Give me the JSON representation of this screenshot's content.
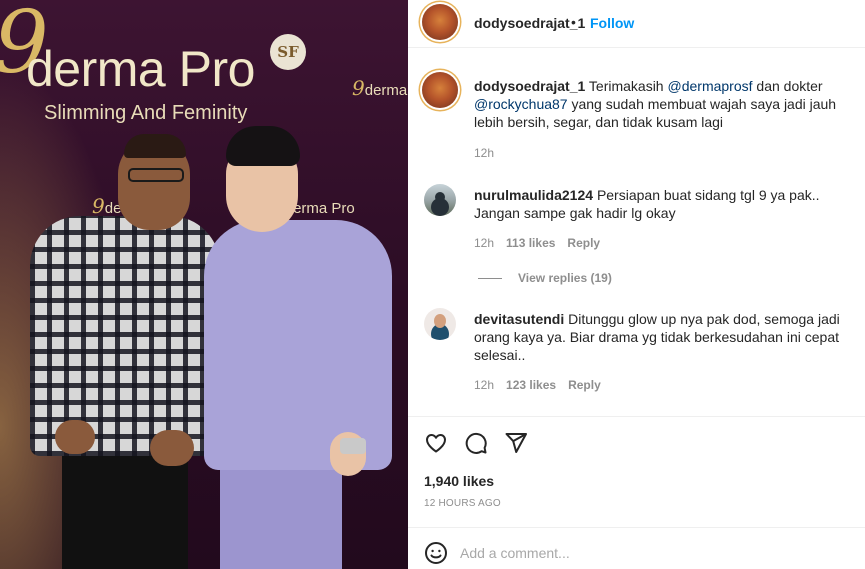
{
  "photo": {
    "brand_mark": "9",
    "brand_name": "derma Pro",
    "brand_tagline": "Slimming And Feminity",
    "brand_badge": "SF",
    "small_logo_text": "derma Pro"
  },
  "post": {
    "author": "dodysoedrajat_1",
    "dot": "•",
    "follow_label": "Follow",
    "caption_prefix": "Terimakasih ",
    "caption_mention1": "@dermaprosf",
    "caption_middle": " dan dokter ",
    "caption_mention2": "@rockychua87",
    "caption_suffix": " yang sudah membuat wajah saya jadi jauh lebih bersih, segar, dan tidak kusam lagi",
    "caption_age": "12h",
    "likes": "1,940 likes",
    "timestamp": "12 HOURS AGO",
    "add_comment_placeholder": "Add a comment..."
  },
  "comments": [
    {
      "user": "nurulmaulida2124",
      "text": "Persiapan buat sidang tgl 9 ya pak.. Jangan sampe gak hadir lg okay",
      "age": "12h",
      "likes": "113 likes",
      "reply_label": "Reply",
      "view_replies": "View replies (19)"
    },
    {
      "user": "devitasutendi",
      "text": "Ditunggu glow up nya pak dod, semoga jadi orang kaya ya. Biar drama yg tidak berkesudahan ini cepat selesai..",
      "age": "12h",
      "likes": "123 likes",
      "reply_label": "Reply"
    }
  ],
  "icons": {
    "like": "heart-icon",
    "comment": "comment-icon",
    "share": "paper-plane-icon",
    "emoji": "smiley-icon"
  }
}
